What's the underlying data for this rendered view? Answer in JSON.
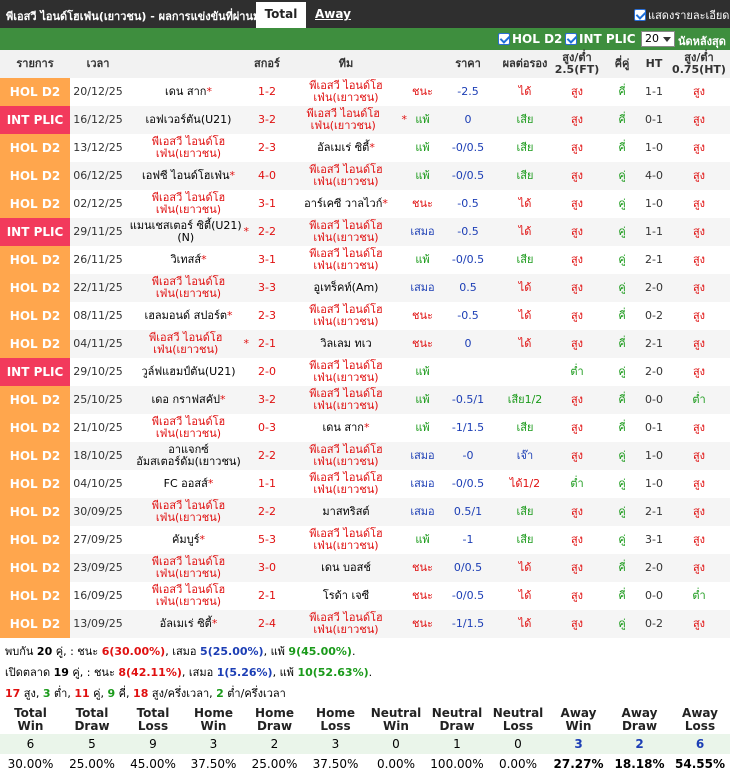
{
  "header": {
    "title": "พีเอสวี ไอนด์โฮเฟ่น(เยาวชน) - ผลการแข่งขันที่ผ่านมา",
    "tab_total": "Total",
    "tab_away": "Away",
    "show_detail": "แสดงรายละเอียด"
  },
  "filters": {
    "hol": "HOL D2",
    "plic": "INT PLIC",
    "count": "20",
    "count_label": "นัดหลังสุด"
  },
  "columns": {
    "league": "รายการ",
    "date": "เวลา",
    "home": "",
    "score": "สกอร์",
    "away": "ทีม",
    "res": "",
    "odds": "ราคา",
    "hres": "ผลต่อรอง",
    "ou": "สูง/ต่ำ 2.5(FT)",
    "oe": "คี่คู่",
    "ht": "HT",
    "htou": "สูง/ต่ำ 0.75(HT)"
  },
  "rows": [
    {
      "lg": "HOL D2",
      "d": "20/12/25",
      "h": "เดน สาก",
      "hs": "*",
      "hh": 0,
      "sc": "1-2",
      "a": "พีเอสวี ไอนด์โฮเฟ่น(เยาวชน)",
      "as": "",
      "ah": 1,
      "r": "ชนะ",
      "rt": "w",
      "o": "-2.5",
      "hr": "ได้",
      "hrt": "w",
      "ou": "สูง",
      "out": "o",
      "oe": "คี่",
      "ht": "1-1",
      "htou": "สูง",
      "htout": "o"
    },
    {
      "lg": "INT PLIC",
      "d": "16/12/25",
      "h": "เอฟเวอร์ตัน(U21)",
      "hs": "",
      "hh": 0,
      "sc": "3-2",
      "a": "พีเอสวี ไอนด์โฮเฟ่น(เยาวชน)",
      "as": "*",
      "ah": 1,
      "r": "แพ้",
      "rt": "l",
      "o": "0",
      "hr": "เสีย",
      "hrt": "l",
      "ou": "สูง",
      "out": "o",
      "oe": "คี่",
      "ht": "0-1",
      "htou": "สูง",
      "htout": "o"
    },
    {
      "lg": "HOL D2",
      "d": "13/12/25",
      "h": "พีเอสวี ไอนด์โฮเฟ่น(เยาวชน)",
      "hs": "",
      "hh": 1,
      "sc": "2-3",
      "a": "อัลเมเร่ ซิตี้",
      "as": "*",
      "ah": 0,
      "r": "แพ้",
      "rt": "l",
      "o": "-0/0.5",
      "hr": "เสีย",
      "hrt": "l",
      "ou": "สูง",
      "out": "o",
      "oe": "คี่",
      "ht": "1-0",
      "htou": "สูง",
      "htout": "o"
    },
    {
      "lg": "HOL D2",
      "d": "06/12/25",
      "h": "เอฟซี ไอนด์โฮเฟ่น",
      "hs": "*",
      "hh": 0,
      "sc": "4-0",
      "a": "พีเอสวี ไอนด์โฮเฟ่น(เยาวชน)",
      "as": "",
      "ah": 1,
      "r": "แพ้",
      "rt": "l",
      "o": "-0/0.5",
      "hr": "เสีย",
      "hrt": "l",
      "ou": "สูง",
      "out": "o",
      "oe": "คู่",
      "ht": "4-0",
      "htou": "สูง",
      "htout": "o"
    },
    {
      "lg": "HOL D2",
      "d": "02/12/25",
      "h": "พีเอสวี ไอนด์โฮเฟ่น(เยาวชน)",
      "hs": "",
      "hh": 1,
      "sc": "3-1",
      "a": "อาร์เคซี วาลไวก์",
      "as": "*",
      "ah": 0,
      "r": "ชนะ",
      "rt": "w",
      "o": "-0.5",
      "hr": "ได้",
      "hrt": "w",
      "ou": "สูง",
      "out": "o",
      "oe": "คู่",
      "ht": "1-0",
      "htou": "สูง",
      "htout": "o"
    },
    {
      "lg": "INT PLIC",
      "d": "29/11/25",
      "h": "แมนเชสเตอร์ ซิตี้(U21)(N)",
      "hs": "*",
      "hh": 0,
      "sc": "2-2",
      "a": "พีเอสวี ไอนด์โฮเฟ่น(เยาวชน)",
      "as": "",
      "ah": 1,
      "r": "เสมอ",
      "rt": "d",
      "o": "-0.5",
      "hr": "ได้",
      "hrt": "w",
      "ou": "สูง",
      "out": "o",
      "oe": "คู่",
      "ht": "1-1",
      "htou": "สูง",
      "htout": "o"
    },
    {
      "lg": "HOL D2",
      "d": "26/11/25",
      "h": "วิเทสส์",
      "hs": "*",
      "hh": 0,
      "sc": "3-1",
      "a": "พีเอสวี ไอนด์โฮเฟ่น(เยาวชน)",
      "as": "",
      "ah": 1,
      "r": "แพ้",
      "rt": "l",
      "o": "-0/0.5",
      "hr": "เสีย",
      "hrt": "l",
      "ou": "สูง",
      "out": "o",
      "oe": "คู่",
      "ht": "2-1",
      "htou": "สูง",
      "htout": "o"
    },
    {
      "lg": "HOL D2",
      "d": "22/11/25",
      "h": "พีเอสวี ไอนด์โฮเฟ่น(เยาวชน)",
      "hs": "",
      "hh": 1,
      "sc": "3-3",
      "a": "อูเทร็คท์(Am)",
      "as": "",
      "ah": 0,
      "r": "เสมอ",
      "rt": "d",
      "o": "0.5",
      "hr": "ได้",
      "hrt": "w",
      "ou": "สูง",
      "out": "o",
      "oe": "คู่",
      "ht": "2-0",
      "htou": "สูง",
      "htout": "o"
    },
    {
      "lg": "HOL D2",
      "d": "08/11/25",
      "h": "เฮลมอนด์ สปอร์ต",
      "hs": "*",
      "hh": 0,
      "sc": "2-3",
      "a": "พีเอสวี ไอนด์โฮเฟ่น(เยาวชน)",
      "as": "",
      "ah": 1,
      "r": "ชนะ",
      "rt": "w",
      "o": "-0.5",
      "hr": "ได้",
      "hrt": "w",
      "ou": "สูง",
      "out": "o",
      "oe": "คี่",
      "ht": "0-2",
      "htou": "สูง",
      "htout": "o"
    },
    {
      "lg": "HOL D2",
      "d": "04/11/25",
      "h": "พีเอสวี ไอนด์โฮเฟ่น(เยาวชน)",
      "hs": "*",
      "hh": 1,
      "sc": "2-1",
      "a": "วิลเลม ทเว",
      "as": "",
      "ah": 0,
      "r": "ชนะ",
      "rt": "w",
      "o": "0",
      "hr": "ได้",
      "hrt": "w",
      "ou": "สูง",
      "out": "o",
      "oe": "คี่",
      "ht": "2-1",
      "htou": "สูง",
      "htout": "o"
    },
    {
      "lg": "INT PLIC",
      "d": "29/10/25",
      "h": "วูล์ฟแฮมป์ตัน(U21)",
      "hs": "",
      "hh": 0,
      "sc": "2-0",
      "a": "พีเอสวี ไอนด์โฮเฟ่น(เยาวชน)",
      "as": "",
      "ah": 1,
      "r": "แพ้",
      "rt": "l",
      "o": "",
      "hr": "",
      "hrt": "w",
      "ou": "ต่ำ",
      "out": "u",
      "oe": "คู่",
      "ht": "2-0",
      "htou": "สูง",
      "htout": "o"
    },
    {
      "lg": "HOL D2",
      "d": "25/10/25",
      "h": "เดอ กราฟสคัป",
      "hs": "*",
      "hh": 0,
      "sc": "3-2",
      "a": "พีเอสวี ไอนด์โฮเฟ่น(เยาวชน)",
      "as": "",
      "ah": 1,
      "r": "แพ้",
      "rt": "l",
      "o": "-0.5/1",
      "hr": "เสีย1/2",
      "hrt": "l",
      "ou": "สูง",
      "out": "o",
      "oe": "คี่",
      "ht": "0-0",
      "htou": "ต่ำ",
      "htout": "u"
    },
    {
      "lg": "HOL D2",
      "d": "21/10/25",
      "h": "พีเอสวี ไอนด์โฮเฟ่น(เยาวชน)",
      "hs": "",
      "hh": 1,
      "sc": "0-3",
      "a": "เดน สาก",
      "as": "*",
      "ah": 0,
      "r": "แพ้",
      "rt": "l",
      "o": "-1/1.5",
      "hr": "เสีย",
      "hrt": "l",
      "ou": "สูง",
      "out": "o",
      "oe": "คี่",
      "ht": "0-1",
      "htou": "สูง",
      "htout": "o"
    },
    {
      "lg": "HOL D2",
      "d": "18/10/25",
      "h": "อาแจกซ์ อัมสเตอร์ดัม(เยาวชน)",
      "hs": "",
      "hh": 0,
      "sc": "2-2",
      "a": "พีเอสวี ไอนด์โฮเฟ่น(เยาวชน)",
      "as": "",
      "ah": 1,
      "r": "เสมอ",
      "rt": "d",
      "o": "-0",
      "hr": "เจ๊า",
      "hrt": "d",
      "ou": "สูง",
      "out": "o",
      "oe": "คู่",
      "ht": "1-0",
      "htou": "สูง",
      "htout": "o"
    },
    {
      "lg": "HOL D2",
      "d": "04/10/25",
      "h": "FC ออสส์",
      "hs": "*",
      "hh": 0,
      "sc": "1-1",
      "a": "พีเอสวี ไอนด์โฮเฟ่น(เยาวชน)",
      "as": "",
      "ah": 1,
      "r": "เสมอ",
      "rt": "d",
      "o": "-0/0.5",
      "hr": "ได้1/2",
      "hrt": "w",
      "ou": "ต่ำ",
      "out": "u",
      "oe": "คู่",
      "ht": "1-0",
      "htou": "สูง",
      "htout": "o"
    },
    {
      "lg": "HOL D2",
      "d": "30/09/25",
      "h": "พีเอสวี ไอนด์โฮเฟ่น(เยาวชน)",
      "hs": "",
      "hh": 1,
      "sc": "2-2",
      "a": "มาสทริสต์",
      "as": "",
      "ah": 0,
      "r": "เสมอ",
      "rt": "d",
      "o": "0.5/1",
      "hr": "เสีย",
      "hrt": "l",
      "ou": "สูง",
      "out": "o",
      "oe": "คู่",
      "ht": "2-1",
      "htou": "สูง",
      "htout": "o"
    },
    {
      "lg": "HOL D2",
      "d": "27/09/25",
      "h": "คัมบูร์",
      "hs": "*",
      "hh": 0,
      "sc": "5-3",
      "a": "พีเอสวี ไอนด์โฮเฟ่น(เยาวชน)",
      "as": "",
      "ah": 1,
      "r": "แพ้",
      "rt": "l",
      "o": "-1",
      "hr": "เสีย",
      "hrt": "l",
      "ou": "สูง",
      "out": "o",
      "oe": "คู่",
      "ht": "3-1",
      "htou": "สูง",
      "htout": "o"
    },
    {
      "lg": "HOL D2",
      "d": "23/09/25",
      "h": "พีเอสวี ไอนด์โฮเฟ่น(เยาวชน)",
      "hs": "",
      "hh": 1,
      "sc": "3-0",
      "a": "เดน บอสช์",
      "as": "",
      "ah": 0,
      "r": "ชนะ",
      "rt": "w",
      "o": "0/0.5",
      "hr": "ได้",
      "hrt": "w",
      "ou": "สูง",
      "out": "o",
      "oe": "คี่",
      "ht": "2-0",
      "htou": "สูง",
      "htout": "o"
    },
    {
      "lg": "HOL D2",
      "d": "16/09/25",
      "h": "พีเอสวี ไอนด์โฮเฟ่น(เยาวชน)",
      "hs": "",
      "hh": 1,
      "sc": "2-1",
      "a": "โรด้า เจซี",
      "as": "",
      "ah": 0,
      "r": "ชนะ",
      "rt": "w",
      "o": "-0/0.5",
      "hr": "ได้",
      "hrt": "w",
      "ou": "สูง",
      "out": "o",
      "oe": "คี่",
      "ht": "0-0",
      "htou": "ต่ำ",
      "htout": "u"
    },
    {
      "lg": "HOL D2",
      "d": "13/09/25",
      "h": "อัลเมเร่ ซิตี้",
      "hs": "*",
      "hh": 0,
      "sc": "2-4",
      "a": "พีเอสวี ไอนด์โฮเฟ่น(เยาวชน)",
      "as": "",
      "ah": 1,
      "r": "ชนะ",
      "rt": "w",
      "o": "-1/1.5",
      "hr": "ได้",
      "hrt": "w",
      "ou": "สูง",
      "out": "o",
      "oe": "คู่",
      "ht": "0-2",
      "htou": "สูง",
      "htout": "o"
    }
  ],
  "summary": {
    "l1_a": "พบกัน ",
    "l1_n": "20",
    "l1_b": " คู่, : ชนะ ",
    "l1_w": "6(30.00%)",
    "l1_c": ", เสมอ ",
    "l1_d": "5(25.00%)",
    "l1_e": ", แพ้ ",
    "l1_l": "9(45.00%)",
    "l1_f": ".",
    "l2_a": "เปิดตลาด ",
    "l2_n": "19",
    "l2_b": " คู่, : ชนะ ",
    "l2_w": "8(42.11%)",
    "l2_c": ", เสมอ ",
    "l2_d": "1(5.26%)",
    "l2_e": ", แพ้ ",
    "l2_l": "10(52.63%)",
    "l2_f": ".",
    "l3_1": "17",
    "l3_1t": " สูง, ",
    "l3_2": "3",
    "l3_2t": " ต่ำ, ",
    "l3_3": "11",
    "l3_3t": " คู่, ",
    "l3_4": "9",
    "l3_4t": " คี่, ",
    "l3_5": "18",
    "l3_5t": " สูง/ครึ่งเวลา, ",
    "l3_6": "2",
    "l3_6t": " ต่ำ/ครึ่งเวลา"
  },
  "stats": {
    "headers": [
      "Total Win",
      "Total Draw",
      "Total Loss",
      "Home Win",
      "Home Draw",
      "Home Loss",
      "Neutral Win",
      "Neutral Draw",
      "Neutral Loss",
      "Away Win",
      "Away Draw",
      "Away Loss"
    ],
    "counts": [
      "6",
      "5",
      "9",
      "3",
      "2",
      "3",
      "0",
      "1",
      "0",
      "3",
      "2",
      "6"
    ],
    "pcts": [
      "30.00%",
      "25.00%",
      "45.00%",
      "37.50%",
      "25.00%",
      "37.50%",
      "0.00%",
      "100.00%",
      "0.00%",
      "27.27%",
      "18.18%",
      "54.55%"
    ]
  }
}
